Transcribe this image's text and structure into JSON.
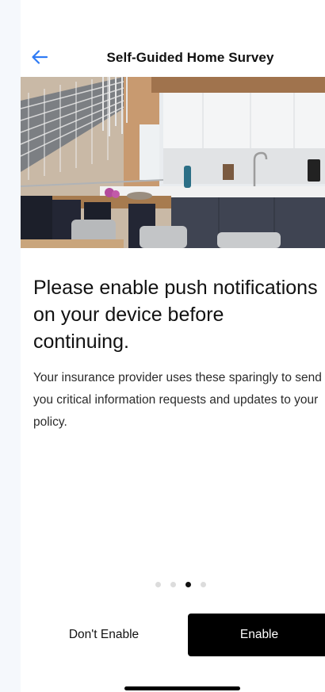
{
  "header": {
    "title": "Self-Guided Home Survey",
    "back_icon": "arrow-left-icon",
    "accent_color": "#2f7bf5"
  },
  "hero": {
    "image": "kitchen-interior-photo"
  },
  "main": {
    "headline": "Please enable push notifications on your device before continuing.",
    "body": "Your insurance provider uses these sparingly to send you critical information requests and updates to your policy."
  },
  "pager": {
    "total": 4,
    "active_index": 2
  },
  "actions": {
    "secondary_label": "Don't Enable",
    "primary_label": "Enable",
    "primary_color": "#000000"
  }
}
